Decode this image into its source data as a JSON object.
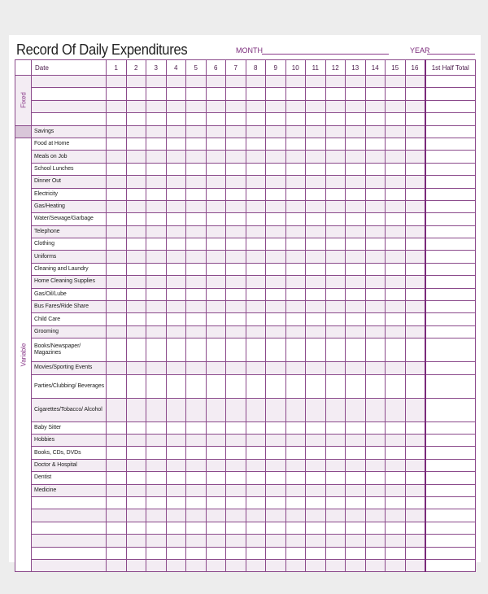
{
  "header": {
    "title": "Record Of Daily Expenditures",
    "month_label": "MONTH",
    "month_value": "",
    "year_label": "YEAR",
    "year_value": ""
  },
  "table": {
    "date_label": "Date",
    "days": [
      "1",
      "2",
      "3",
      "4",
      "5",
      "6",
      "7",
      "8",
      "9",
      "10",
      "11",
      "12",
      "13",
      "14",
      "15",
      "16"
    ],
    "total_label": "1st Half Total",
    "sections": {
      "fixed_label": "Fixed",
      "variable_label": "Variable"
    },
    "fixed_rows": [
      "",
      "",
      "",
      ""
    ],
    "savings_label": "Savings",
    "variable_rows": [
      "Food at Home",
      "Meals on Job",
      "School Lunches",
      "Dinner Out",
      "Electricity",
      "Gas/Heating",
      "Water/Sewage/Garbage",
      "Telephone",
      "Clothing",
      "Uniforms",
      "Cleaning and Laundry",
      "Home Cleaning Supplies",
      "Gas/Oil/Lube",
      "Bus Fares/Ride Share",
      "Child Care",
      "Grooming",
      "Books/Newspaper/ Magazines",
      "Movies/Sporting Events",
      "Parties/Clubbing/ Beverages",
      "Cigarettes/Tobacco/ Alcohol",
      "Baby Sitter",
      "Hobbies",
      "Books, CDs, DVDs",
      "Doctor & Hospital",
      "Dentist",
      "Medicine",
      "",
      "",
      "",
      "",
      "",
      ""
    ]
  },
  "colors": {
    "accent": "#7a2a7a",
    "grid": "#8b4a8b",
    "shade": "#f3ecf3",
    "side_fill": "#d9c6d9"
  }
}
